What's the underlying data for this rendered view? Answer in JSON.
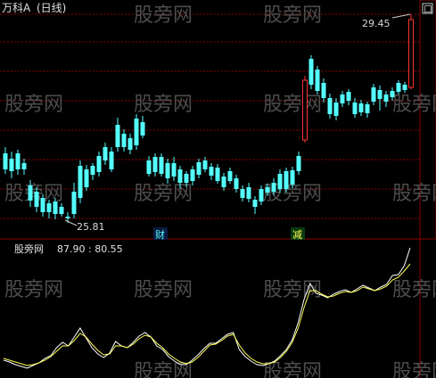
{
  "stock": {
    "name": "万科A",
    "period": "(日线)"
  },
  "price_annotations": {
    "high_label": "29.45",
    "low_label": "25.81"
  },
  "markers": {
    "cai": "财",
    "jian": "减"
  },
  "window_button": "口",
  "watermark": "股旁网",
  "colors": {
    "up": "#ff3232",
    "down": "#54ffff",
    "grid": "#8b0000",
    "line_white": "#ffffff",
    "line_yellow": "#ffff54"
  },
  "chart_data": [
    {
      "type": "line",
      "title": "股旁网",
      "values_label": "87.90 : 80.55",
      "y_range": [
        0,
        100
      ],
      "series": [
        {
          "name": "",
          "values": [
            14,
            12,
            9,
            7,
            5,
            8,
            11,
            16,
            19,
            28,
            34,
            30,
            40,
            50,
            39,
            28,
            21,
            17,
            22,
            35,
            30,
            28,
            34,
            41,
            45,
            40,
            30,
            26,
            18,
            13,
            9,
            9,
            14,
            20,
            27,
            33,
            33,
            38,
            43,
            45,
            26,
            18,
            13,
            9,
            8,
            10,
            13,
            19,
            26,
            37,
            56,
            82,
            100,
            89,
            87,
            84,
            88,
            91,
            93,
            90,
            94,
            98,
            95,
            92,
            96,
            99,
            109,
            110,
            120,
            140
          ]
        },
        {
          "name": "",
          "values": [
            16,
            14,
            12,
            10,
            8,
            9,
            11,
            14,
            18,
            24,
            30,
            30,
            36,
            44,
            40,
            32,
            25,
            20,
            21,
            30,
            30,
            28,
            32,
            38,
            42,
            40,
            33,
            28,
            21,
            16,
            12,
            10,
            12,
            17,
            24,
            31,
            32,
            36,
            41,
            43,
            31,
            22,
            16,
            12,
            10,
            10,
            12,
            17,
            24,
            34,
            50,
            73,
            92,
            92,
            88,
            85,
            86,
            89,
            91,
            90,
            92,
            96,
            94,
            92,
            94,
            97,
            104,
            107,
            114,
            122
          ]
        }
      ]
    }
  ]
}
